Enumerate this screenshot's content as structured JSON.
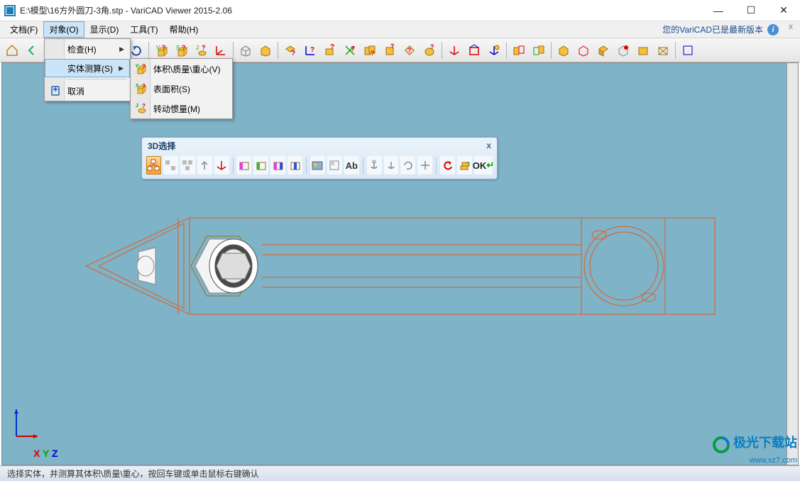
{
  "titlebar": {
    "title": "E:\\模型\\16方外圆刀-3角.stp - VariCAD Viewer 2015-2.06"
  },
  "menubar": {
    "items": [
      {
        "label": "文档(F)"
      },
      {
        "label": "对象(O)",
        "active": true
      },
      {
        "label": "显示(D)"
      },
      {
        "label": "工具(T)"
      },
      {
        "label": "帮助(H)"
      }
    ],
    "info_text": "您的VariCAD已是最新版本"
  },
  "dropdown": {
    "items": [
      {
        "label": "检查(H)",
        "submenu": true
      },
      {
        "label": "实体测算(S)",
        "submenu": true,
        "hover": true
      },
      {
        "label": "取消"
      }
    ]
  },
  "submenu": {
    "items": [
      {
        "label": "体积\\质量\\重心(V)",
        "badge": "V"
      },
      {
        "label": "表面积(S)",
        "badge": "S"
      },
      {
        "label": "转动惯量(M)",
        "badge": "J"
      }
    ]
  },
  "float_toolbar": {
    "title": "3D选择",
    "buttons": [
      "org",
      "grp",
      "grp2",
      "up",
      "axis",
      "c1",
      "c2",
      "c3",
      "c4",
      "img",
      "sq1",
      "Ab",
      "a1",
      "a2",
      "a3",
      "a4",
      "undo",
      "stack",
      "OK"
    ]
  },
  "axis": {
    "x": "X",
    "y": "Y",
    "z": "Z"
  },
  "statusbar": {
    "text": "选择实体，并测算其体积\\质量\\重心，按回车键或单击鼠标右键确认"
  },
  "watermark": {
    "name": "极光下载站",
    "url": "www.xz7.com"
  },
  "toolbar_icons": [
    "home",
    "back",
    "fwd",
    "tree",
    "hand",
    "sep",
    "undo",
    "redo",
    "sep",
    "vb",
    "sb",
    "jb",
    "axis",
    "sep",
    "cube1",
    "cube2",
    "sep",
    "q1",
    "q2",
    "q3",
    "q4",
    "q5",
    "q6",
    "q7",
    "q8",
    "sep",
    "ax1",
    "ax2",
    "ax3",
    "sep",
    "b1",
    "b2",
    "sep",
    "v1",
    "v2",
    "v3",
    "v4",
    "v5",
    "v6",
    "sep",
    "end"
  ]
}
